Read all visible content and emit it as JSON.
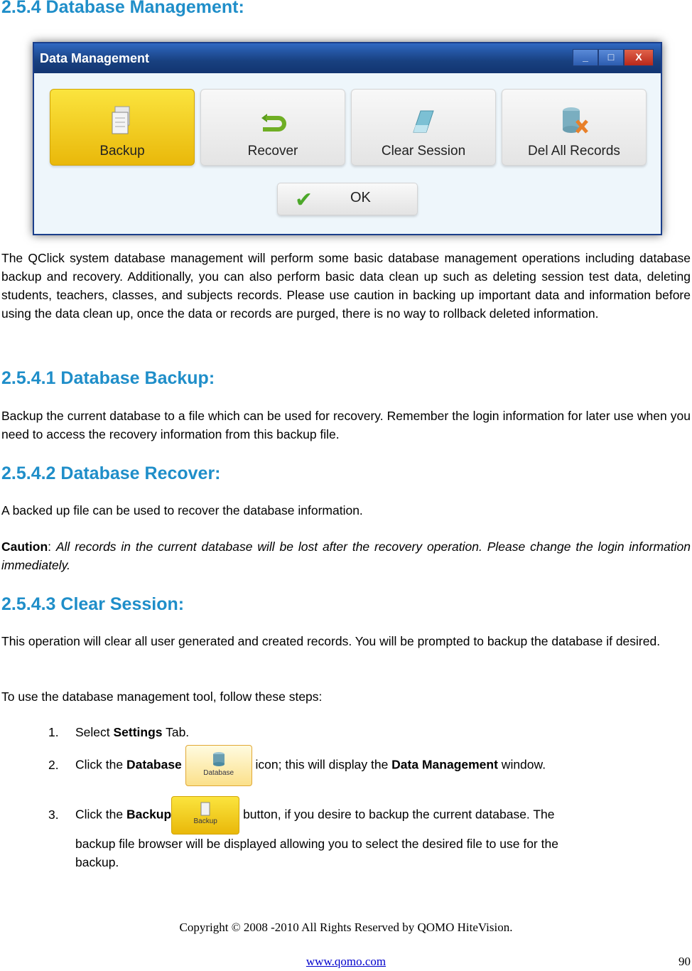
{
  "heading_main": "2.5.4 Database Management:",
  "dialog": {
    "title": "Data Management",
    "window_buttons": {
      "minimize": "_",
      "maximize": "□",
      "close": "X"
    },
    "buttons": [
      {
        "label": "Backup",
        "icon": "backup-documents-icon",
        "active": true
      },
      {
        "label": "Recover",
        "icon": "undo-arrow-icon",
        "active": false
      },
      {
        "label": "Clear Session",
        "icon": "eraser-icon",
        "active": false
      },
      {
        "label": "Del All Records",
        "icon": "database-delete-icon",
        "active": false
      }
    ],
    "ok_label": "OK",
    "ok_icon": "✔"
  },
  "intro": "The QClick system database management will perform some basic database management operations including database backup and recovery. Additionally, you can also perform basic data clean up such as deleting session test data, deleting students, teachers, classes, and subjects records. Please use caution in backing up important data and information before using the data clean up, once the data or records are purged, there is no way to rollback deleted information.",
  "backup": {
    "heading": "2.5.4.1 Database Backup:",
    "text": "Backup the current database to a file which can be used for recovery. Remember the login information for later use when you need to access the recovery information from this backup file."
  },
  "recover": {
    "heading": "2.5.4.2 Database Recover:",
    "text": "A backed up file can be used to recover the database information.",
    "caution_label": "Caution",
    "caution_text": "All records in the current database will be lost after the recovery operation. Please change the login information immediately."
  },
  "clear": {
    "heading": "2.5.4.3 Clear Session:",
    "text": "This operation will clear all user generated and created records. You will be prompted to backup the database if desired."
  },
  "steps_intro": "To use the database management tool, follow these steps:",
  "steps": [
    {
      "num": "1.",
      "pre": "Select ",
      "bold": "Settings",
      "post": " Tab."
    },
    {
      "num": "2.",
      "pre": "Click the ",
      "bold": "Database",
      "button_label": "Database",
      "post": " icon; this will display the ",
      "bold2": "Data Management",
      "post2": " window."
    },
    {
      "num": "3.",
      "pre": "Click the ",
      "bold": "Backup",
      "button_label": "Backup",
      "post": " button, if you desire to backup the current database. The",
      "cont": "backup file browser will be displayed allowing you to select the desired file to use for the",
      "cont2": "backup."
    }
  ],
  "footer": {
    "copyright": "Copyright © 2008 -2010 All Rights Reserved by QOMO HiteVision.",
    "link": "www.qomo.com",
    "page": "90"
  }
}
